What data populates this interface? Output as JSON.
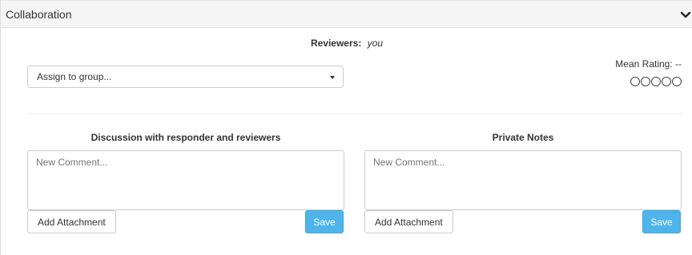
{
  "panel": {
    "title": "Collaboration",
    "collapse_icon": "chevron-down-icon"
  },
  "reviewers": {
    "label": "Reviewers:",
    "value": "you"
  },
  "assign": {
    "value": "Assign to group...",
    "icon": "caret-down-icon"
  },
  "rating": {
    "label": "Mean Rating: --",
    "max": 5,
    "filled": 0
  },
  "discussion": {
    "heading": "Discussion with responder and reviewers",
    "placeholder": "New Comment...",
    "attach_label": "Add Attachment",
    "save_label": "Save"
  },
  "private_notes": {
    "heading": "Private Notes",
    "placeholder": "New Comment...",
    "attach_label": "Add Attachment",
    "save_label": "Save"
  },
  "colors": {
    "save_button": "#4fb4ea",
    "header_bg": "#f5f5f5"
  }
}
